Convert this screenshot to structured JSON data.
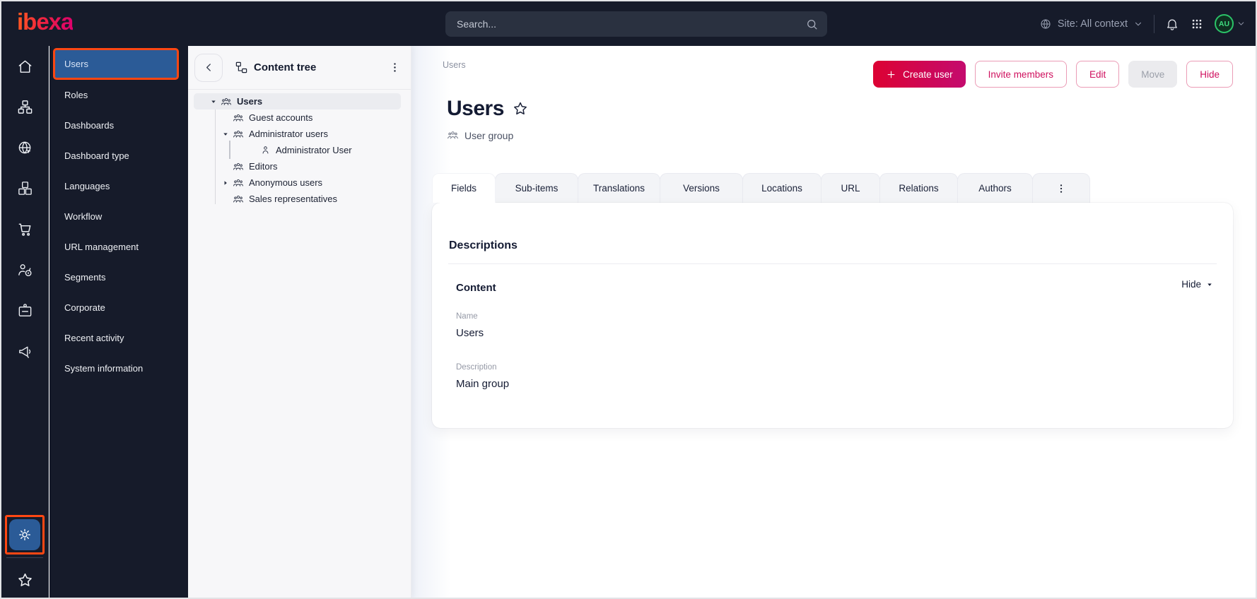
{
  "topbar": {
    "logo_text": "ibexa",
    "search_placeholder": "Search...",
    "site_context_label": "Site: All context",
    "avatar_initials": "AU"
  },
  "sidebar": {
    "rail": [
      {
        "icon": "home-icon"
      },
      {
        "icon": "sitemap-icon"
      },
      {
        "icon": "globe-cursor-icon"
      },
      {
        "icon": "boxes-icon"
      },
      {
        "icon": "cart-icon"
      },
      {
        "icon": "audience-target-icon"
      },
      {
        "icon": "id-badge-icon"
      },
      {
        "icon": "megaphone-icon"
      }
    ],
    "items": [
      {
        "label": "Users",
        "selected": true
      },
      {
        "label": "Roles"
      },
      {
        "label": "Dashboards"
      },
      {
        "label": "Dashboard type"
      },
      {
        "label": "Languages"
      },
      {
        "label": "Workflow"
      },
      {
        "label": "URL management"
      },
      {
        "label": "Segments"
      },
      {
        "label": "Corporate"
      },
      {
        "label": "Recent activity"
      },
      {
        "label": "System information"
      }
    ],
    "footer": {
      "settings_icon": "gear-icon",
      "bookmarks_icon": "star-icon"
    }
  },
  "content_tree": {
    "title": "Content tree",
    "items": [
      {
        "label": "Users",
        "depth": 0,
        "expander": "expanded",
        "icon": "user-group",
        "selected": true
      },
      {
        "label": "Guest accounts",
        "depth": 1,
        "expander": "none",
        "icon": "user-group"
      },
      {
        "label": "Administrator users",
        "depth": 1,
        "expander": "expanded",
        "icon": "user-group"
      },
      {
        "label": "Administrator User",
        "depth": 2,
        "expander": "none",
        "icon": "user"
      },
      {
        "label": "Editors",
        "depth": 1,
        "expander": "none",
        "icon": "user-group"
      },
      {
        "label": "Anonymous users",
        "depth": 1,
        "expander": "collapsed",
        "icon": "user-group"
      },
      {
        "label": "Sales representatives",
        "depth": 1,
        "expander": "none",
        "icon": "user-group"
      }
    ]
  },
  "main": {
    "breadcrumb": "Users",
    "title": "Users",
    "content_type": "User group",
    "actions": [
      {
        "label": "Create user",
        "variant": "primary"
      },
      {
        "label": "Invite members",
        "variant": "outline"
      },
      {
        "label": "Edit",
        "variant": "outline"
      },
      {
        "label": "Move",
        "variant": "disabled"
      },
      {
        "label": "Hide",
        "variant": "outline"
      }
    ],
    "tabs": [
      {
        "label": "Fields",
        "active": true
      },
      {
        "label": "Sub-items"
      },
      {
        "label": "Translations"
      },
      {
        "label": "Versions"
      },
      {
        "label": "Locations"
      },
      {
        "label": "URL"
      },
      {
        "label": "Relations"
      },
      {
        "label": "Authors"
      },
      {
        "icon": "kebab-icon",
        "active": false
      }
    ],
    "card": {
      "heading": "Descriptions",
      "section_title": "Content",
      "collapse_label": "Hide",
      "fields": [
        {
          "label": "Name",
          "value": "Users"
        },
        {
          "label": "Description",
          "value": "Main group"
        }
      ]
    }
  },
  "colors": {
    "topbar_bg": "#161b2a",
    "accent_orange": "#ff4713",
    "selected_blue": "#2b5b97",
    "primary_gradient_start": "#dc0233",
    "primary_gradient_end": "#c40b6e",
    "action_pink": "#cf105e",
    "avatar_green": "#2bc368",
    "panel_bg": "#f7f7f9",
    "selected_row_bg": "#ebecf0"
  }
}
